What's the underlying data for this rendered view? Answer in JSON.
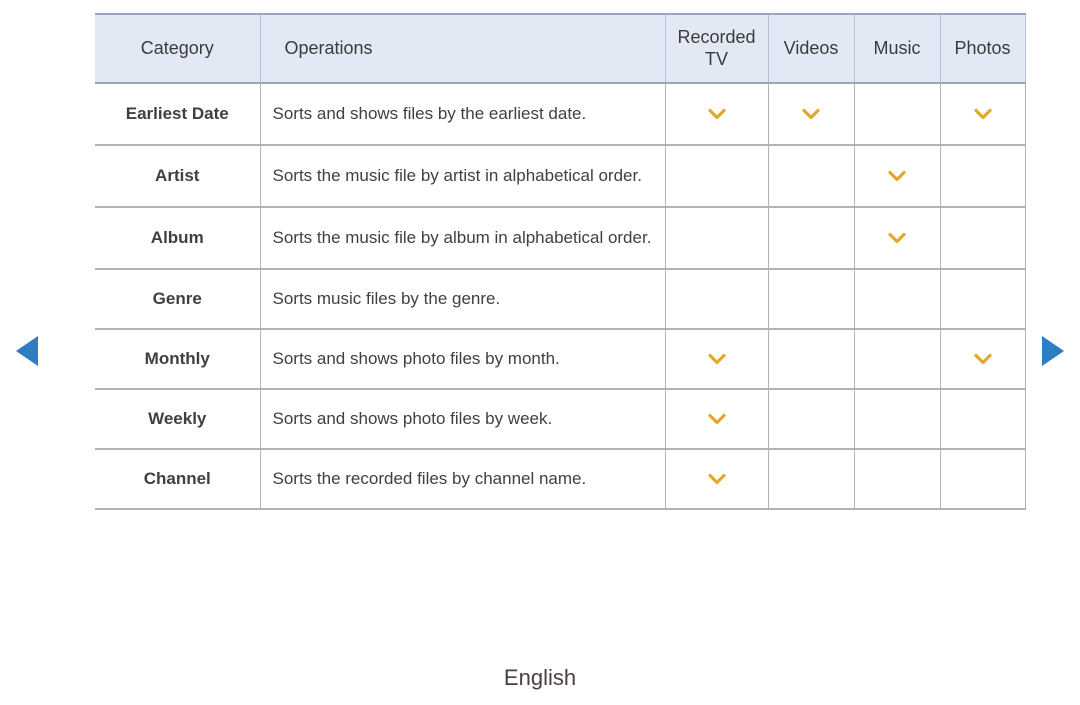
{
  "nav": {
    "prev_icon": "triangle-left-icon",
    "next_icon": "triangle-right-icon",
    "arrow_color": "#2e7dc2"
  },
  "table": {
    "headers": {
      "category": "Category",
      "operations": "Operations",
      "recorded_tv": "Recorded TV",
      "videos": "Videos",
      "music": "Music",
      "photos": "Photos"
    },
    "mark_icon": "chevron-down-icon",
    "mark_color": "#e0a92b",
    "header_bg": "#e3e9f4",
    "category_color": "#2e7dc2",
    "rows": [
      {
        "category": "Earliest Date",
        "operations": "Sorts and shows files by the earliest date.",
        "recorded_tv": true,
        "videos": true,
        "music": false,
        "photos": true
      },
      {
        "category": "Artist",
        "operations": "Sorts the music file by artist in alphabetical order.",
        "recorded_tv": false,
        "videos": false,
        "music": true,
        "photos": false
      },
      {
        "category": "Album",
        "operations": "Sorts the music file by album in alphabetical order.",
        "recorded_tv": false,
        "videos": false,
        "music": true,
        "photos": false
      },
      {
        "category": "Genre",
        "operations": "Sorts music files by the genre.",
        "recorded_tv": false,
        "videos": false,
        "music": false,
        "photos": false
      },
      {
        "category": "Monthly",
        "operations": "Sorts and shows photo files by month.",
        "recorded_tv": true,
        "videos": false,
        "music": false,
        "photos": true
      },
      {
        "category": "Weekly",
        "operations": "Sorts and shows photo files by week.",
        "recorded_tv": true,
        "videos": false,
        "music": false,
        "photos": false
      },
      {
        "category": "Channel",
        "operations": "Sorts the recorded files by channel name.",
        "recorded_tv": true,
        "videos": false,
        "music": false,
        "photos": false
      }
    ]
  },
  "footer": {
    "language": "English"
  }
}
